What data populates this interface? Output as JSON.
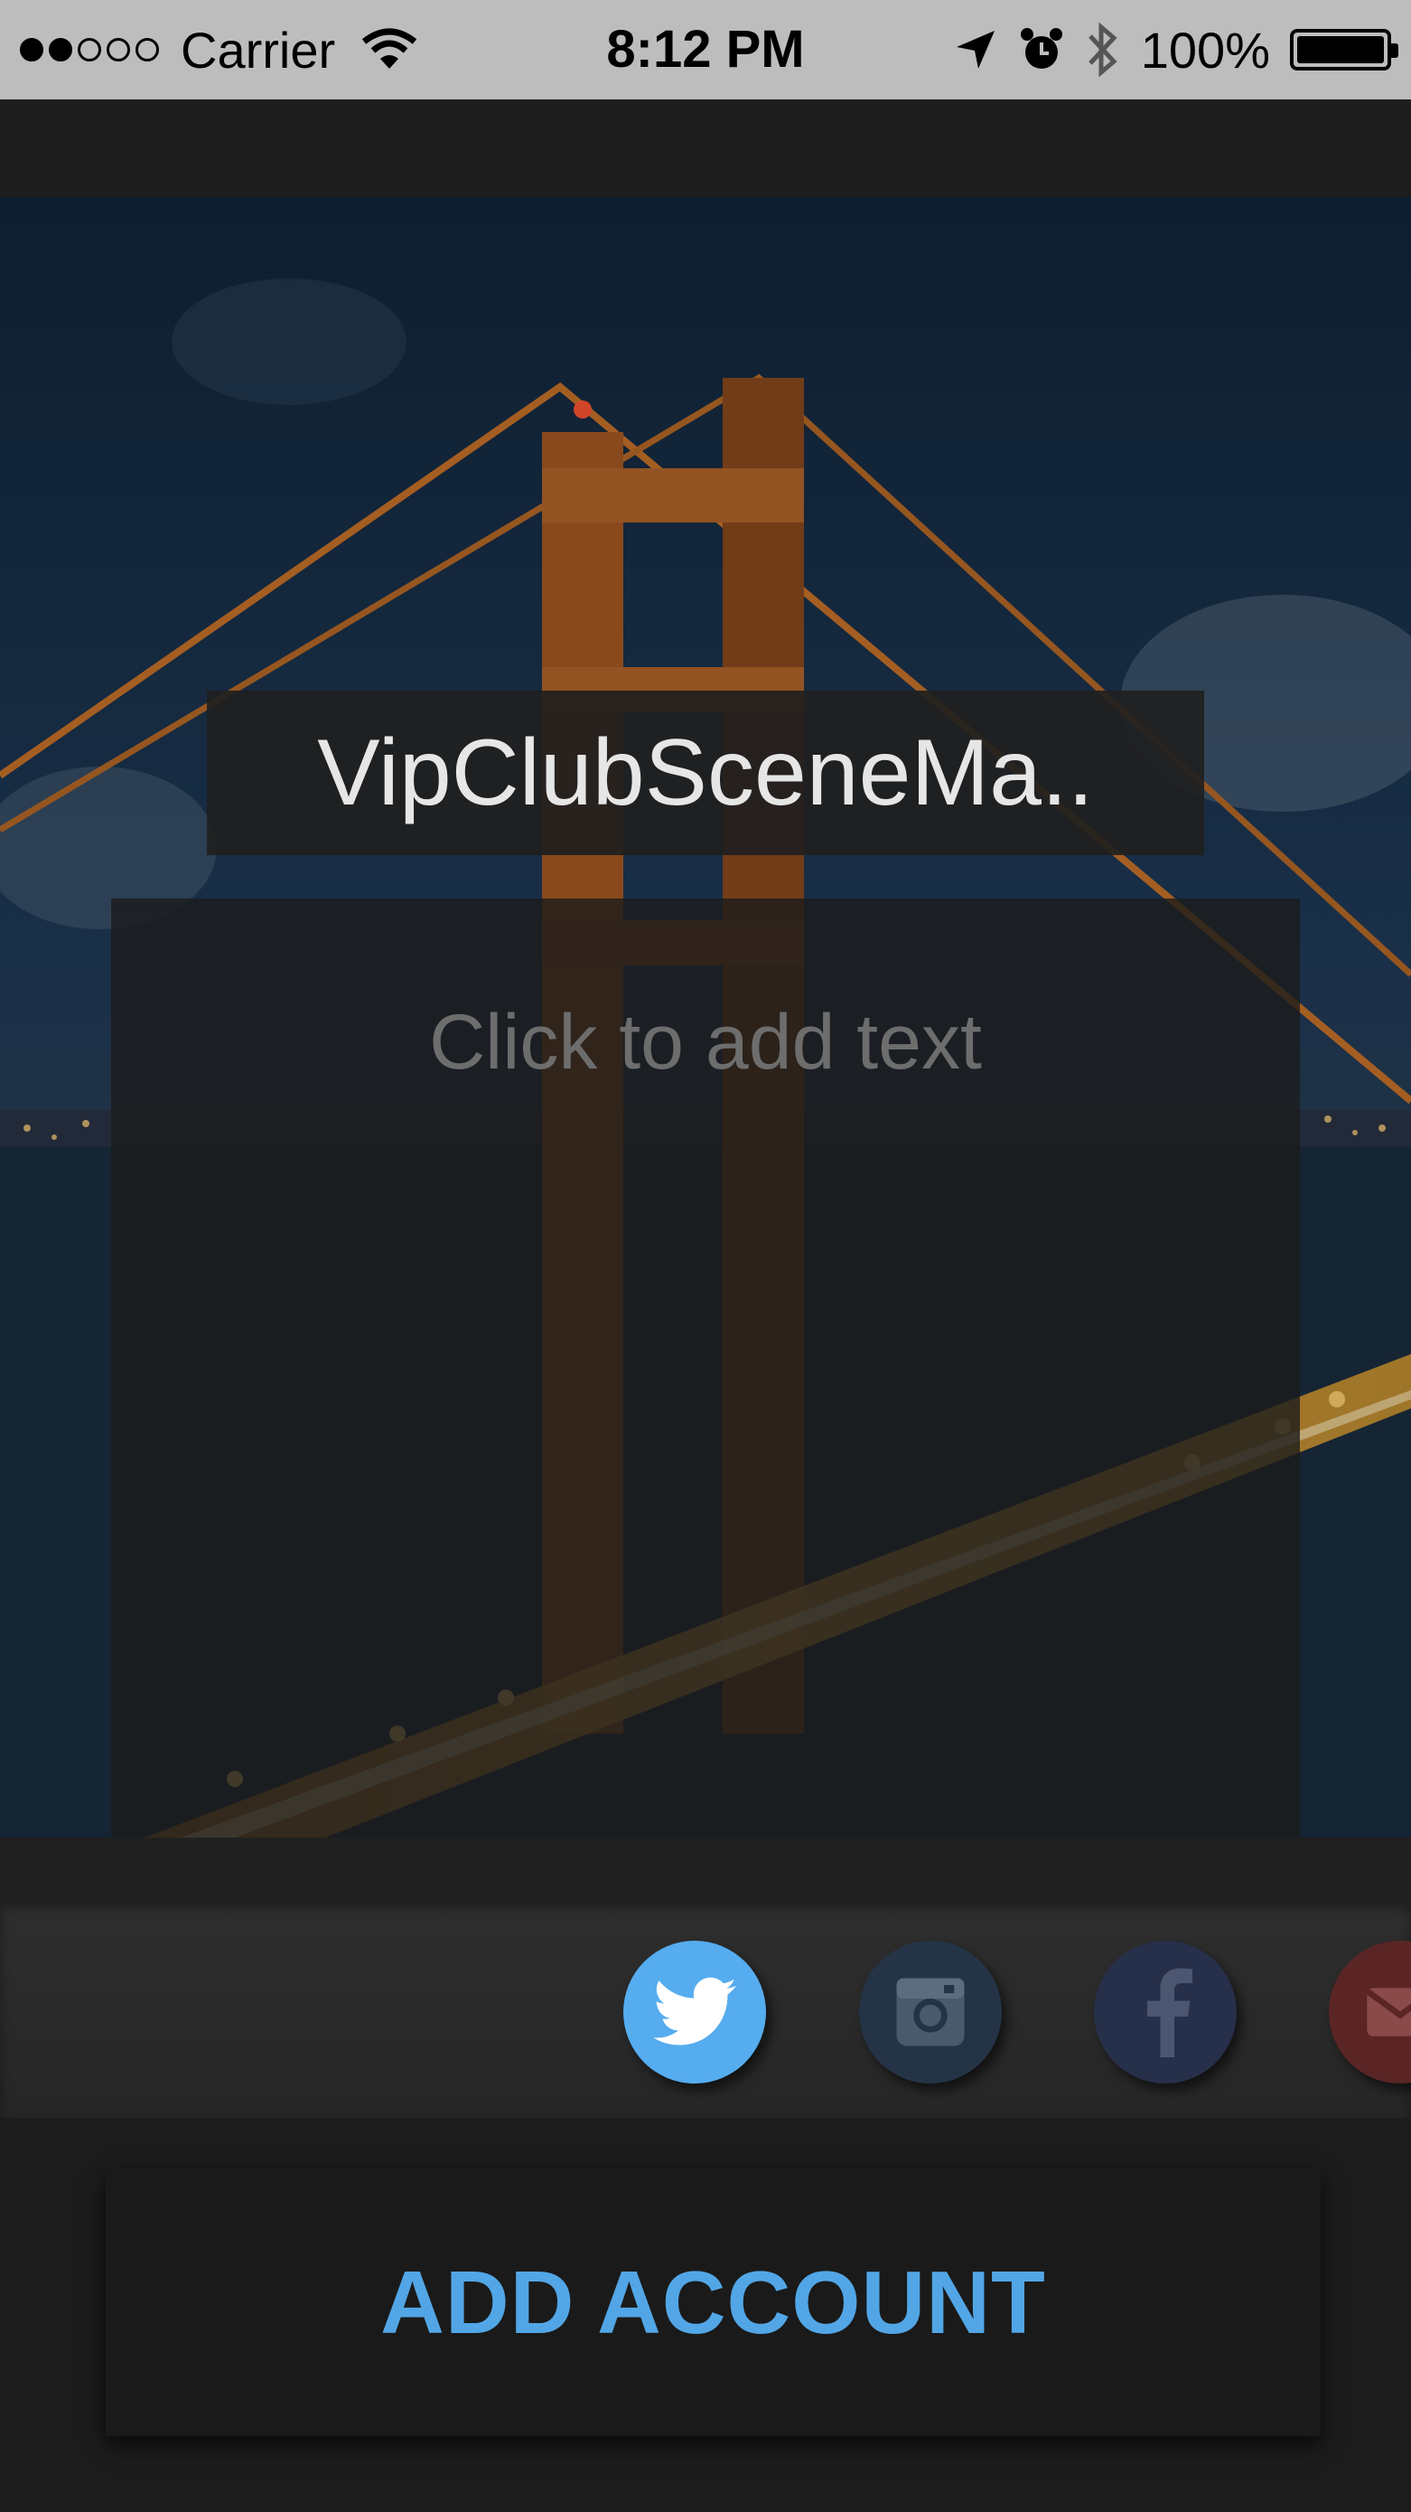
{
  "status_bar": {
    "carrier": "Carrier",
    "time": "8:12 PM",
    "battery": "100%"
  },
  "scene": {
    "title": "VipClubSceneMa..",
    "text_placeholder": "Click to add text"
  },
  "share": {
    "networks": [
      "twitter",
      "instagram",
      "facebook",
      "mail"
    ],
    "selected": "twitter",
    "colors": {
      "twitter": "#55acee",
      "instagram": "#243446",
      "facebook": "#27304a",
      "mail": "#5b2525"
    }
  },
  "add_account": {
    "label": "ADD ACCOUNT",
    "color": "#52a6e6"
  }
}
